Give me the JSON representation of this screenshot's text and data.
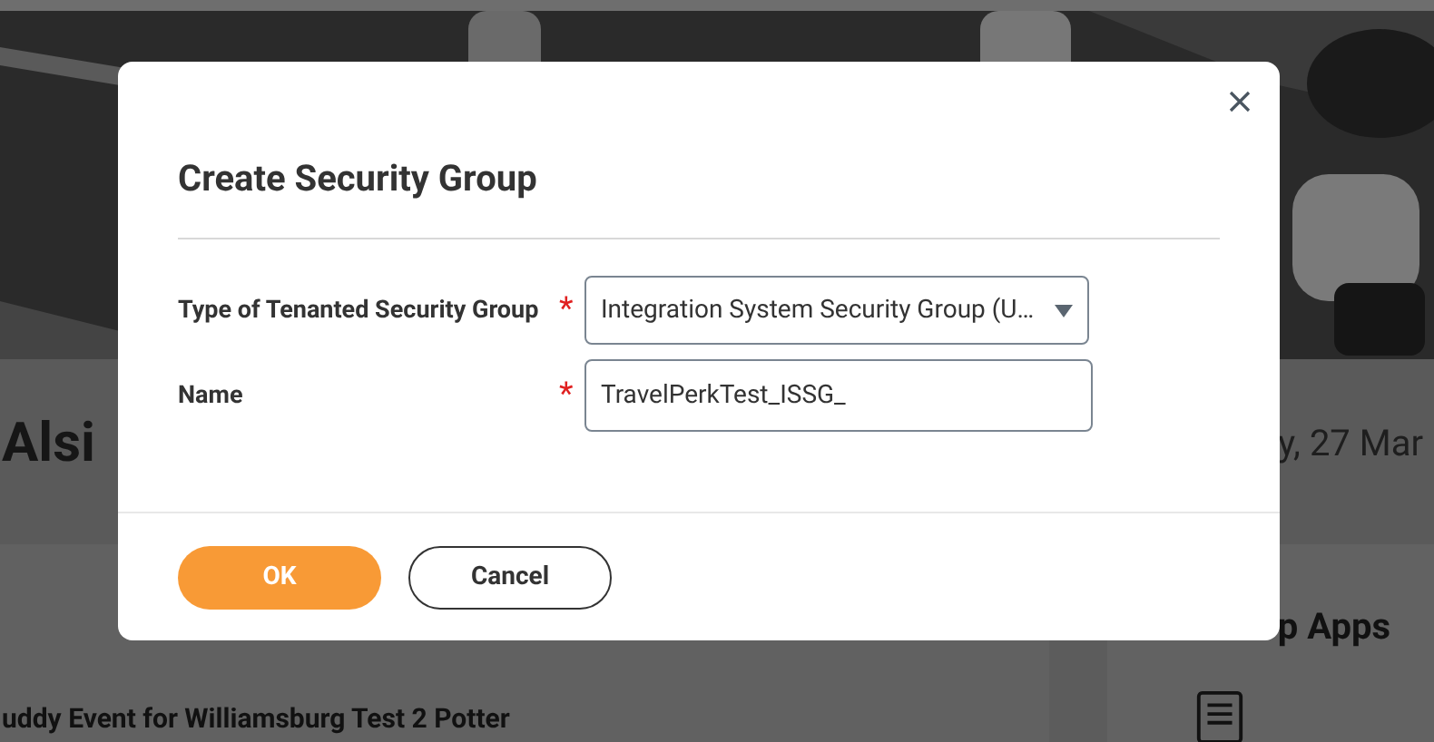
{
  "background": {
    "page_title": "Alsi",
    "date": "y, 27 Mar",
    "card_title": "uddy Event for Williamsburg Test 2 Potter",
    "side_card_title": "p Apps"
  },
  "dialog": {
    "title": "Create Security Group",
    "fields": [
      {
        "kind": "select",
        "label": "Type of Tenanted Security Group",
        "required": true,
        "required_mark": "*",
        "value": "Integration System Security Group (U…"
      },
      {
        "kind": "text",
        "label": "Name",
        "required": true,
        "required_mark": "*",
        "value": "TravelPerkTest_ISSG_"
      }
    ],
    "buttons": [
      {
        "kind": "primary",
        "label": "OK"
      },
      {
        "kind": "secondary",
        "label": "Cancel"
      }
    ]
  }
}
